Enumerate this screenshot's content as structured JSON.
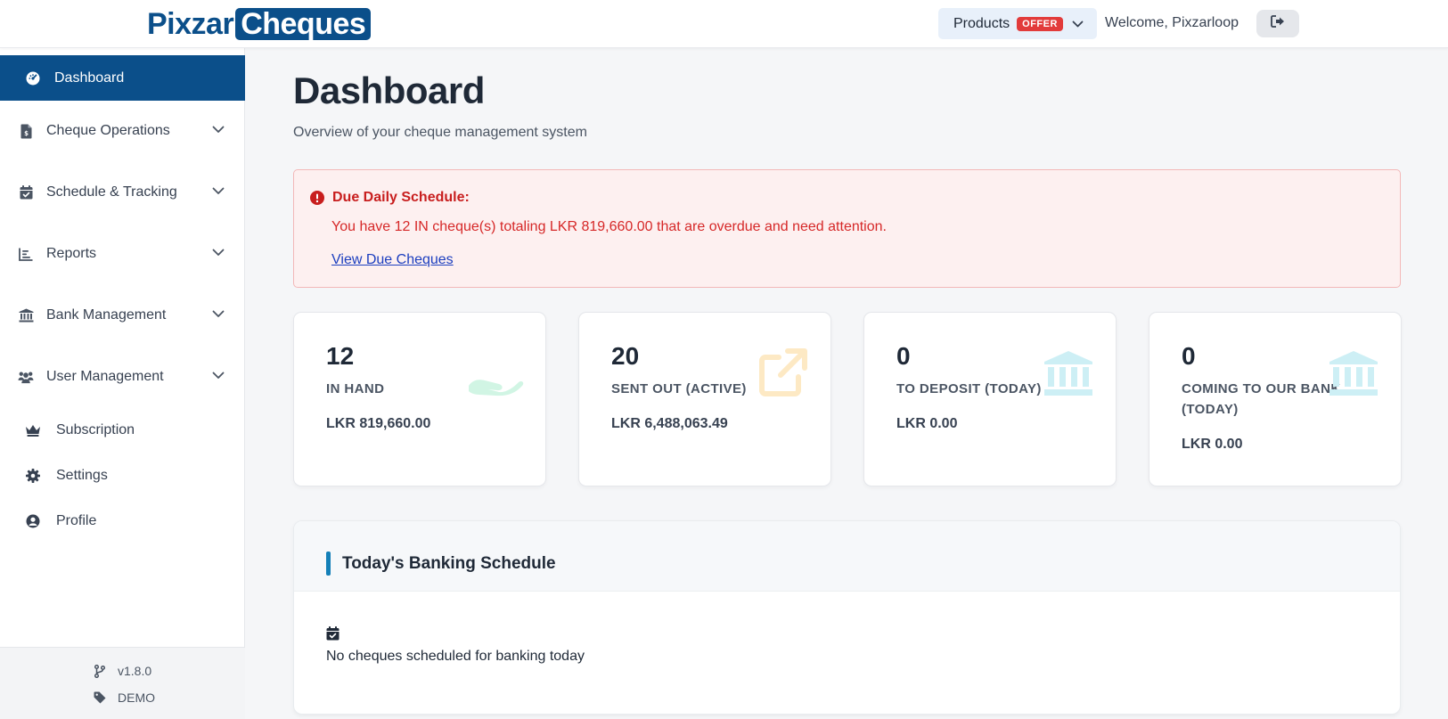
{
  "header": {
    "logo_part1": "Pixzar",
    "logo_part2": "Cheques",
    "products_label": "Products",
    "offer_badge": "OFFER",
    "welcome": "Welcome, Pixzarloop"
  },
  "sidebar": {
    "active": {
      "label": "Dashboard",
      "icon": "gauge-icon"
    },
    "groups": [
      {
        "label": "Cheque Operations",
        "icon": "file-invoice-icon"
      },
      {
        "label": "Schedule & Tracking",
        "icon": "calendar-check-icon"
      },
      {
        "label": "Reports",
        "icon": "bar-chart-icon"
      },
      {
        "label": "Bank Management",
        "icon": "bank-icon"
      },
      {
        "label": "User Management",
        "icon": "users-icon"
      }
    ],
    "links": [
      {
        "label": "Subscription",
        "icon": "crown-icon"
      },
      {
        "label": "Settings",
        "icon": "gear-icon"
      },
      {
        "label": "Profile",
        "icon": "user-circle-icon"
      }
    ],
    "footer": {
      "version": "v1.8.0",
      "mode": "DEMO"
    }
  },
  "main": {
    "title": "Dashboard",
    "subtitle": "Overview of your cheque management system",
    "alert": {
      "title": "Due Daily Schedule:",
      "message": "You have 12 IN cheque(s) totaling LKR 819,660.00 that are overdue and need attention.",
      "link": "View Due Cheques"
    },
    "cards": [
      {
        "count": "12",
        "label": "IN HAND",
        "amount": "LKR 819,660.00",
        "icon": "hand-holding-icon",
        "color": "#d1f5e4"
      },
      {
        "count": "20",
        "label": "SENT OUT (ACTIVE)",
        "amount": "LKR 6,488,063.49",
        "icon": "external-link-icon",
        "color": "#fde9c4"
      },
      {
        "count": "0",
        "label": "TO DEPOSIT (TODAY)",
        "amount": "LKR 0.00",
        "icon": "bank-icon",
        "color": "#cdeff5"
      },
      {
        "count": "0",
        "label": "COMING TO OUR BANK (TODAY)",
        "amount": "LKR 0.00",
        "icon": "bank-icon",
        "color": "#cdeff5"
      }
    ],
    "schedule": {
      "title": "Today's Banking Schedule",
      "empty_message": "No cheques scheduled for banking today"
    }
  },
  "colors": {
    "brand": "#0b4f8a",
    "offer": "#e23b3b",
    "alert_text": "#d62828",
    "alert_bg": "#fdf0f0",
    "schedule_accent": "#1480b8"
  }
}
